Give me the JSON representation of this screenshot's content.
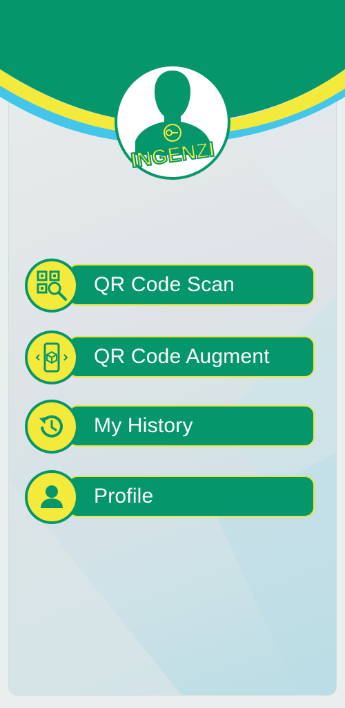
{
  "brand": {
    "name": "INGENZI",
    "colors": {
      "green": "#06966b",
      "yellow": "#f3ea3c",
      "cyan": "#43c6ea",
      "white": "#ffffff"
    }
  },
  "menu": {
    "items": [
      {
        "label": "QR Code Scan",
        "icon": "qr-scan-icon"
      },
      {
        "label": "QR Code Augment",
        "icon": "ar-phone-cube-icon"
      },
      {
        "label": "My History",
        "icon": "history-icon"
      },
      {
        "label": "Profile",
        "icon": "user-profile-icon"
      }
    ]
  }
}
